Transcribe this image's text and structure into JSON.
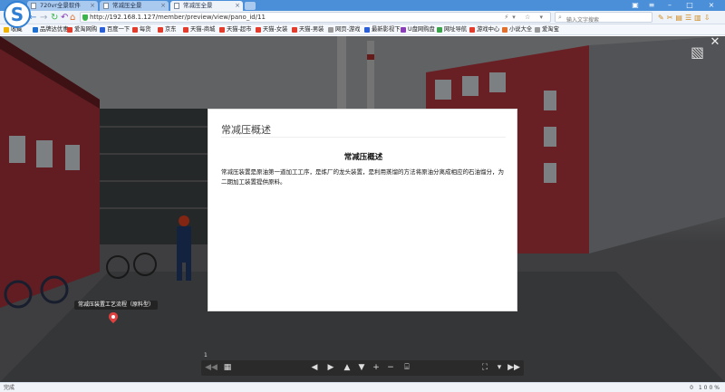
{
  "browser": {
    "tabs": [
      {
        "label": "720vr全景软件",
        "active": false
      },
      {
        "label": "常减压全景",
        "active": false
      },
      {
        "label": "常减压全景",
        "active": true
      }
    ],
    "url": "http://192.168.1.127/member/preview/view/pano_id/11",
    "search_placeholder": "输入文字搜索",
    "bookmarks": [
      {
        "label": "收藏",
        "color": "#f0b400"
      },
      {
        "label": "品牌达优惠",
        "color": "#1f6fd0"
      },
      {
        "label": "爱淘网购",
        "color": "#e43c2c"
      },
      {
        "label": "百度一下",
        "color": "#2a5fd8"
      },
      {
        "label": "每货",
        "color": "#e43c2c"
      },
      {
        "label": "京东",
        "color": "#e43c2c"
      },
      {
        "label": "天猫-商城",
        "color": "#e43c2c"
      },
      {
        "label": "天猫-超市",
        "color": "#e43c2c"
      },
      {
        "label": "天猫-女装",
        "color": "#e43c2c"
      },
      {
        "label": "天猫-男装",
        "color": "#e43c2c"
      },
      {
        "label": "网页-游戏",
        "color": "#999999"
      },
      {
        "label": "最新影视下",
        "color": "#2a5fd8"
      },
      {
        "label": "U盘网购盘",
        "color": "#8a3fb8"
      },
      {
        "label": "网址导航",
        "color": "#3ba34a"
      },
      {
        "label": "游戏中心",
        "color": "#e43c2c"
      },
      {
        "label": "小说大全",
        "color": "#e0702c"
      },
      {
        "label": "爱淘宝",
        "color": "#999999"
      }
    ],
    "status_left": "完成",
    "status_right": "0   100%"
  },
  "pano": {
    "hotspot_label": "常减压装置工艺流程（原料型）",
    "page_number": "1"
  },
  "modal": {
    "title": "常减压概述",
    "article_title": "常减压概述",
    "article_body": "常减压装置是原油第一道加工工序，是炼厂的龙头装置，是利用蒸馏的方法将原油分离成相应的石油馏分，为二期加工装置提供原料。"
  }
}
